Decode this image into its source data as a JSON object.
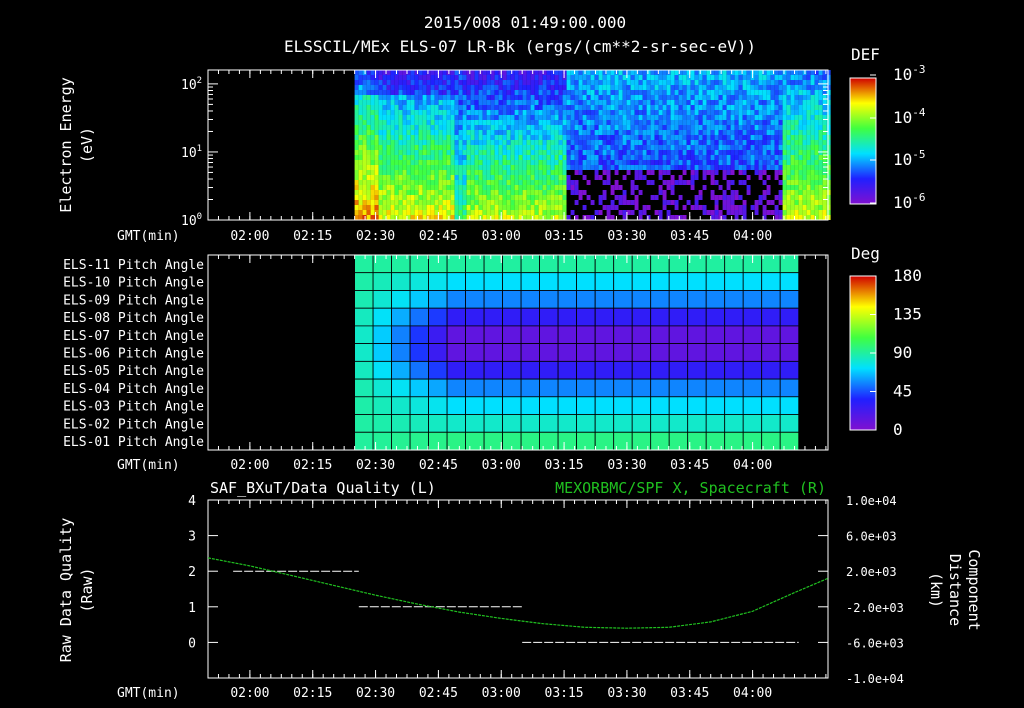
{
  "header": {
    "timestamp": "2015/008 01:49:00.000",
    "title": "ELSSCIL/MEx ELS-07 LR-Bk  (ergs/(cm**2-sr-sec-eV))"
  },
  "time_ticks": [
    "02:00",
    "02:15",
    "02:30",
    "02:45",
    "03:00",
    "03:15",
    "03:30",
    "03:45",
    "04:00"
  ],
  "gmt_label": "GMT(min)",
  "chart_data": [
    {
      "type": "heatmap",
      "title": "ELSSCIL/MEx ELS-07 LR-Bk  (ergs/(cm**2-sr-sec-eV))",
      "ylabel": "Electron Energy (eV)",
      "ylabel_lines": [
        "Electron Energy",
        "(eV)"
      ],
      "xlabel": "GMT(min)",
      "x_range_min": [
        0,
        148
      ],
      "data_start_min": 35,
      "y_scale": "log",
      "y_range": [
        1,
        160
      ],
      "y_ticks": [
        {
          "base": "10",
          "exp": "0",
          "value": 1
        },
        {
          "base": "10",
          "exp": "1",
          "value": 10
        },
        {
          "base": "10",
          "exp": "2",
          "value": 100
        }
      ],
      "colorbar": {
        "label": "DEF",
        "ticks": [
          {
            "base": "10",
            "exp": "-3"
          },
          {
            "base": "10",
            "exp": "-4"
          },
          {
            "base": "10",
            "exp": "-5"
          },
          {
            "base": "10",
            "exp": "-6"
          }
        ]
      },
      "colors": {
        "high": "#d00000",
        "mid": "#40ff40",
        "low": "#2020ff",
        "floor": "#8010d0"
      }
    },
    {
      "type": "heatmap",
      "xlabel": "GMT(min)",
      "x_range_min": [
        0,
        148
      ],
      "data_range_min": [
        35,
        141
      ],
      "rows": [
        "ELS-11 Pitch Angle",
        "ELS-10 Pitch Angle",
        "ELS-09 Pitch Angle",
        "ELS-08 Pitch Angle",
        "ELS-07 Pitch Angle",
        "ELS-06 Pitch Angle",
        "ELS-05 Pitch Angle",
        "ELS-04 Pitch Angle",
        "ELS-03 Pitch Angle",
        "ELS-02 Pitch Angle",
        "ELS-01 Pitch Angle"
      ],
      "row_values_deg": [
        90,
        72,
        55,
        30,
        12,
        12,
        30,
        55,
        72,
        82,
        95
      ],
      "colorbar": {
        "label": "Deg",
        "ticks": [
          "180",
          "135",
          "90",
          "45",
          "0"
        ],
        "range": [
          0,
          180
        ]
      },
      "colors": {
        "high": "#d00000",
        "mid": "#40ff40",
        "low": "#2020ff",
        "floor": "#8010d0"
      }
    },
    {
      "type": "line",
      "title_left": "SAF_BXuT/Data Quality (L)",
      "title_right": "MEXORBMC/SPF X, Spacecraft (R)",
      "ylabel_left_lines": [
        "Raw Data Quality",
        "(Raw)"
      ],
      "ylabel_right_lines": [
        "Component",
        "Distance",
        "(km)"
      ],
      "xlabel": "GMT(min)",
      "x_range_min": [
        0,
        148
      ],
      "ylim_left": [
        -1,
        4
      ],
      "yticks_left": [
        "4",
        "3",
        "2",
        "1",
        "0"
      ],
      "ylim_right": [
        -10000,
        10000
      ],
      "yticks_right": [
        "1.0e+04",
        "6.0e+03",
        "2.0e+03",
        "-2.0e+03",
        "-6.0e+03",
        "-1.0e+04"
      ],
      "series": [
        {
          "name": "SAF_BXuT/Data Quality",
          "axis": "left",
          "color": "#ffffff",
          "segments": [
            {
              "x": [
                6,
                36
              ],
              "y": 2
            },
            {
              "x": [
                36,
                75
              ],
              "y": 1
            },
            {
              "x": [
                75,
                141
              ],
              "y": 0
            }
          ]
        },
        {
          "name": "MEXORBMC/SPF X, Spacecraft",
          "axis": "right",
          "color": "#20c020",
          "x": [
            0,
            10,
            20,
            30,
            40,
            50,
            60,
            70,
            80,
            90,
            100,
            110,
            120,
            130,
            140,
            148
          ],
          "y": [
            3500,
            2600,
            1500,
            400,
            -700,
            -1700,
            -2600,
            -3300,
            -3900,
            -4300,
            -4400,
            -4300,
            -3700,
            -2500,
            -400,
            1200
          ]
        }
      ]
    }
  ]
}
